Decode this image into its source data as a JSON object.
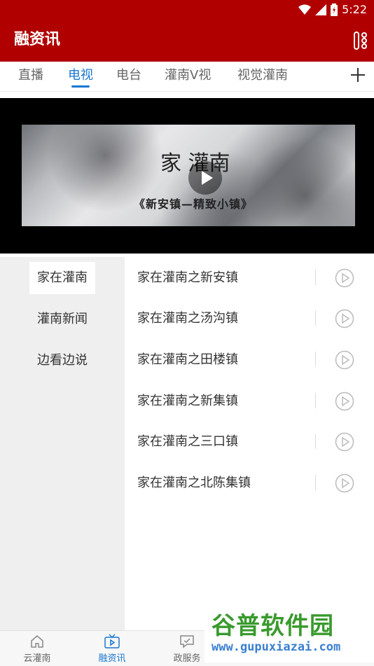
{
  "status_bar": {
    "time": "5:22",
    "icons": [
      "wifi-icon",
      "signal-icon",
      "battery-icon"
    ]
  },
  "app_bar": {
    "title": "融资讯",
    "menu_icon": "menu-icon"
  },
  "tabs": [
    {
      "label": "直播",
      "active": false
    },
    {
      "label": "电视",
      "active": true
    },
    {
      "label": "电台",
      "active": false
    },
    {
      "label": "灌南V视",
      "active": false
    },
    {
      "label": "视觉灌南",
      "active": false
    }
  ],
  "tab_add_icon": "plus-icon",
  "video": {
    "calligraphy": "家 灌南",
    "caption": "《新安镇—精致小镇》",
    "play_icon": "play-icon"
  },
  "categories": [
    {
      "label": "家在灌南",
      "active": true
    },
    {
      "label": "灌南新闻",
      "active": false
    },
    {
      "label": "边看边说",
      "active": false
    }
  ],
  "items": [
    {
      "label": "家在灌南之新安镇"
    },
    {
      "label": "家在灌南之汤沟镇"
    },
    {
      "label": "家在灌南之田楼镇"
    },
    {
      "label": "家在灌南之新集镇"
    },
    {
      "label": "家在灌南之三口镇"
    },
    {
      "label": "家在灌南之北陈集镇"
    }
  ],
  "bottom_nav": [
    {
      "label": "云灌南",
      "icon": "home-icon",
      "active": false
    },
    {
      "label": "融资讯",
      "icon": "tv-icon",
      "active": true
    },
    {
      "label": "政服务",
      "icon": "chat-icon",
      "active": false
    }
  ],
  "watermark": {
    "title": "谷普软件园",
    "url": "www.gupuxiazai.com"
  },
  "colors": {
    "primary": "#b00000",
    "accent": "#1976d2",
    "sidebar_bg": "#efefef"
  }
}
